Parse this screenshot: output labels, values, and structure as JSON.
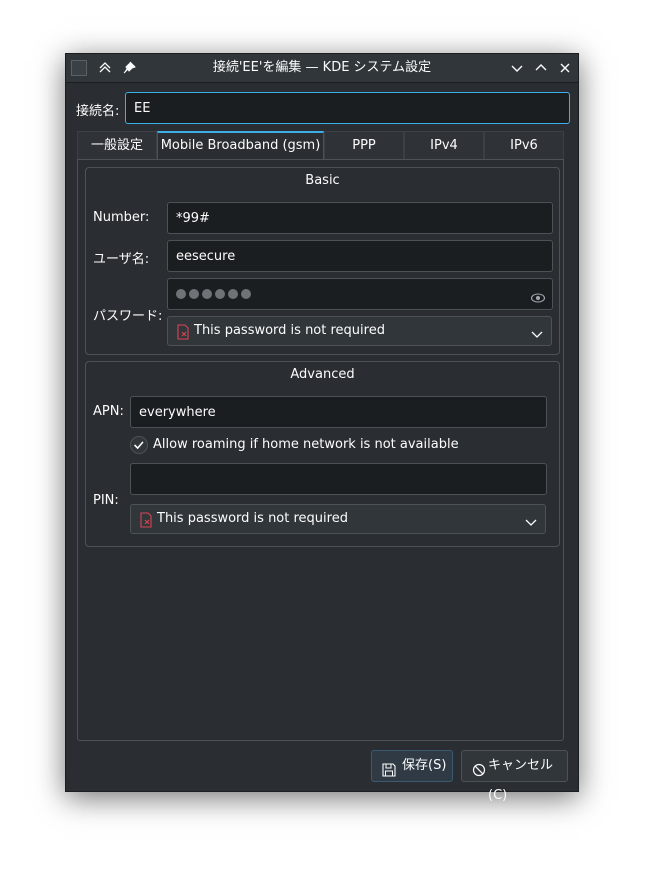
{
  "window": {
    "title": "接続'EE'を編集 — KDE システム設定"
  },
  "connection": {
    "name_label": "接続名:",
    "name_value": "EE"
  },
  "tabs": [
    {
      "label": "一般設定"
    },
    {
      "label": "Mobile Broadband (gsm)"
    },
    {
      "label": "PPP"
    },
    {
      "label": "IPv4"
    },
    {
      "label": "IPv6"
    }
  ],
  "basic": {
    "title": "Basic",
    "number_label": "Number:",
    "number_value": "*99#",
    "username_label": "ユーザ名:",
    "username_value": "eesecure",
    "password_label": "パスワード:",
    "password_mask_count": 6,
    "password_option": "This password is not required"
  },
  "advanced": {
    "title": "Advanced",
    "apn_label": "APN:",
    "apn_value": "everywhere",
    "roaming_label": "Allow roaming if home network is not available",
    "roaming_checked": true,
    "pin_label": "PIN:",
    "pin_value": "",
    "pin_option": "This password is not required"
  },
  "buttons": {
    "save": "保存(S)",
    "cancel": "キャンセル(C)"
  },
  "colors": {
    "accent": "#3daee9",
    "window_bg": "#2a2e32",
    "field_bg": "#1b1e20",
    "warning_icon": "#da4453"
  }
}
